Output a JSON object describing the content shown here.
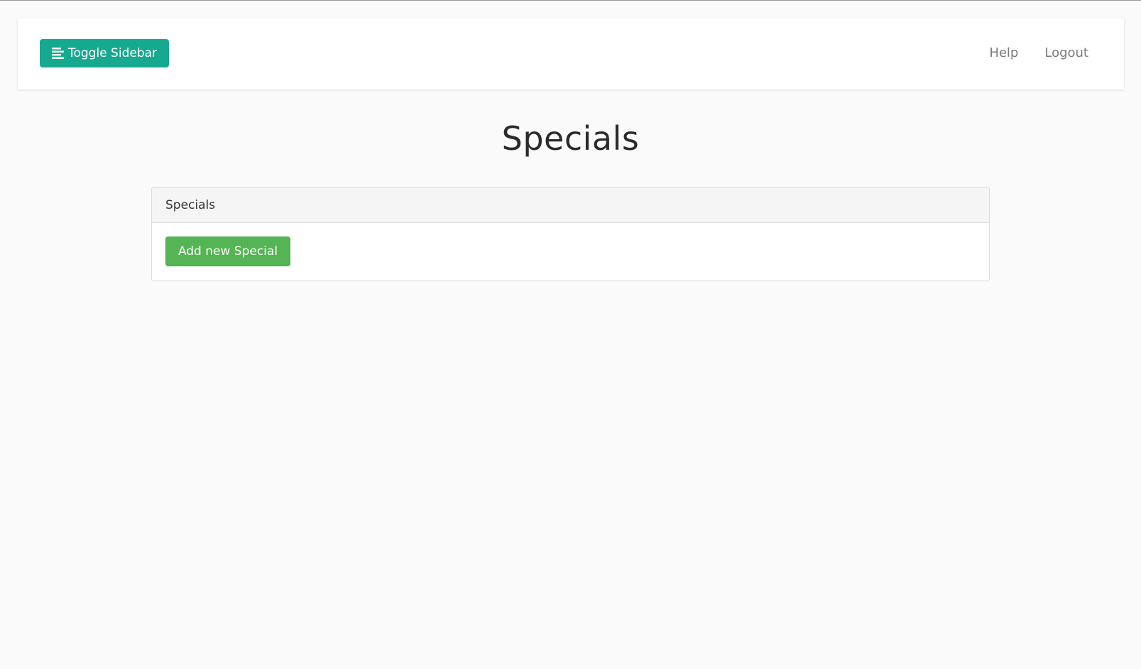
{
  "navbar": {
    "toggle_label": "Toggle Sidebar",
    "toggle_icon": "align-left-icon",
    "links": [
      {
        "label": "Help"
      },
      {
        "label": "Logout"
      }
    ]
  },
  "page": {
    "title": "Specials"
  },
  "panel": {
    "heading": "Specials",
    "add_button_label": "Add new Special"
  },
  "colors": {
    "toggle_button": "#17a98f",
    "add_button": "#55b554",
    "background": "#fafafa"
  }
}
